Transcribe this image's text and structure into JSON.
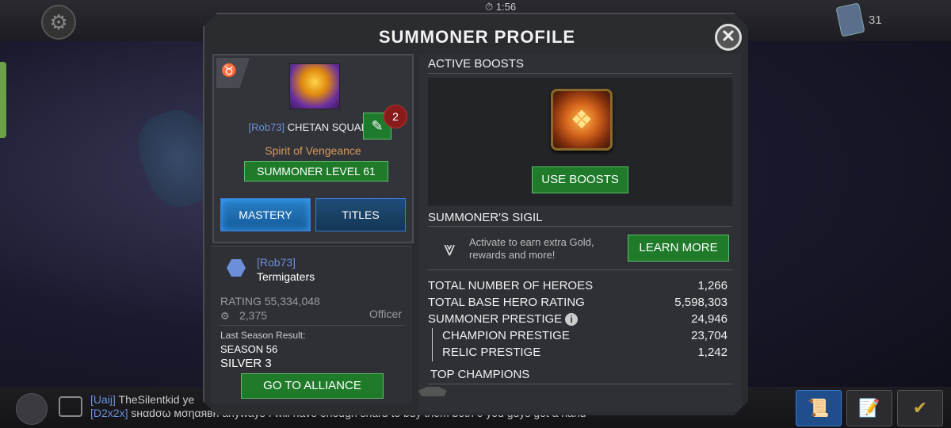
{
  "hud": {
    "timer": "⏱ 1:56",
    "card_count": "31"
  },
  "chat": {
    "line1_tag": "[Uaij]",
    "line1_name": "TheSilentkid",
    "line1_text": "ye",
    "line2_tag": "[D2x2x]",
    "line2_text": "ѕнαdσω мσηαявн  anyways I will have enough shard to buy them both e you guys got a hand"
  },
  "modal": {
    "title": "SUMMONER PROFILE",
    "close_label": "✕"
  },
  "profile": {
    "alliance_tag": "[Rob73]",
    "name": "CHETAN  SQUAD",
    "notif_count": "2",
    "title": "Spirit of Vengeance",
    "level": "SUMMONER LEVEL 61",
    "tab_mastery": "MASTERY",
    "tab_titles": "TITLES"
  },
  "alliance": {
    "tag": "[Rob73]",
    "name": "Termigaters",
    "rating": "RATING 55,334,048",
    "members": "2,375",
    "role": "Officer",
    "last_season_label": "Last Season Result:",
    "season": "SEASON 56",
    "tier": "SILVER 3",
    "go_button": "GO TO ALLIANCE"
  },
  "boosts": {
    "header": "ACTIVE BOOSTS",
    "use_button": "USE BOOSTS"
  },
  "sigil": {
    "header": "SUMMONER'S SIGIL",
    "description": "Activate to earn extra Gold, rewards and more!",
    "learn_button": "LEARN MORE"
  },
  "stats": [
    {
      "label": "TOTAL NUMBER OF HEROES",
      "value": "1,266"
    },
    {
      "label": "TOTAL BASE HERO RATING",
      "value": "5,598,303"
    },
    {
      "label": "SUMMONER PRESTIGE",
      "value": "24,946"
    },
    {
      "label": "CHAMPION PRESTIGE",
      "value": "23,704"
    },
    {
      "label": "RELIC PRESTIGE",
      "value": "1,242"
    }
  ],
  "top_champions": {
    "header": "TOP CHAMPIONS"
  },
  "colors": {
    "accent_green": "#1f7a2a",
    "alliance_blue": "#6c8fd9",
    "title_orange": "#d89a5a",
    "notif_red": "#8a1b1b"
  }
}
